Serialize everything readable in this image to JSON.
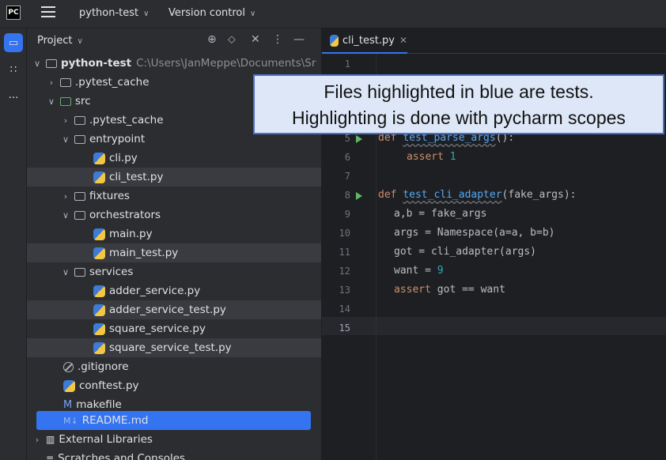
{
  "topbar": {
    "logo": "PC",
    "project_name": "python-test",
    "vcs_label": "Version control"
  },
  "project_panel": {
    "title": "Project",
    "tree": [
      {
        "label": "python-test",
        "path": "C:\\Users\\JanMeppe\\Documents\\Sr"
      },
      {
        "label": ".pytest_cache"
      },
      {
        "label": "src"
      },
      {
        "label": ".pytest_cache"
      },
      {
        "label": "entrypoint"
      },
      {
        "label": "cli.py"
      },
      {
        "label": "cli_test.py"
      },
      {
        "label": "fixtures"
      },
      {
        "label": "orchestrators"
      },
      {
        "label": "main.py"
      },
      {
        "label": "main_test.py"
      },
      {
        "label": "services"
      },
      {
        "label": "adder_service.py"
      },
      {
        "label": "adder_service_test.py"
      },
      {
        "label": "square_service.py"
      },
      {
        "label": "square_service_test.py"
      },
      {
        "label": ".gitignore"
      },
      {
        "label": "conftest.py"
      },
      {
        "label": "makefile"
      },
      {
        "label": "README.md"
      },
      {
        "label": "External Libraries"
      },
      {
        "label": "Scratches and Consoles"
      }
    ]
  },
  "editor": {
    "tab_label": "cli_test.py",
    "line_numbers": [
      "1",
      "5",
      "6",
      "7",
      "8",
      "9",
      "10",
      "11",
      "12",
      "13",
      "14",
      "15"
    ],
    "code": {
      "l5_def": "def ",
      "l5_fn": "test_parse_args",
      "l5_rest": "():",
      "l6_kw": "assert ",
      "l6_num": "1",
      "l8_def": "def ",
      "l8_fn": "test_cli_adapter",
      "l8_rest": "(fake_args):",
      "l9": "a,b = fake_args",
      "l10": "args = Namespace(a=a, b=b)",
      "l11": "got = cli_adapter(args)",
      "l12_a": "want = ",
      "l12_num": "9",
      "l13_kw": "assert ",
      "l13_rest": "got == want"
    }
  },
  "annotation": {
    "line1": "Files highlighted in blue are tests.",
    "line2": "Highlighting is done with pycharm scopes"
  }
}
